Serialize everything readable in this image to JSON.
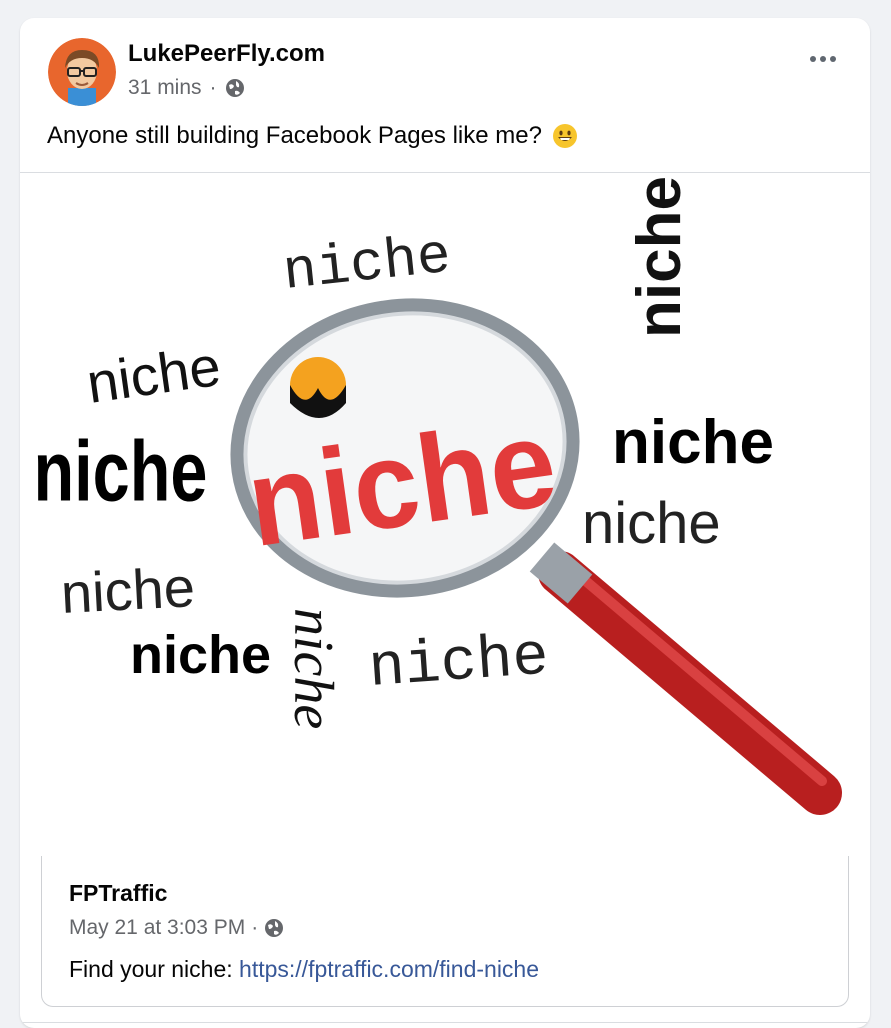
{
  "post": {
    "author": "LukePeerFly.com",
    "time": "31 mins",
    "separator": "·",
    "privacy_icon": "globe-icon",
    "text": "Anyone still building Facebook Pages like me?",
    "emoji": "grinning-face-emoji",
    "more_icon": "more-options-icon"
  },
  "image": {
    "words": [
      "niche",
      "niche",
      "niche",
      "niche",
      "niche",
      "niche",
      "niche",
      "niche",
      "niche",
      "niche",
      "niche"
    ],
    "center_word": "niche",
    "description_icon": "magnifying-glass-icon"
  },
  "shared": {
    "author": "FPTraffic",
    "time": "May 21 at 3:03 PM",
    "separator": "·",
    "text_prefix": "Find your niche: ",
    "link": "https://fptraffic.com/find-niche"
  },
  "colors": {
    "link": "#385898",
    "secondary_text": "#65676b",
    "accent_red": "#e23b3b"
  }
}
